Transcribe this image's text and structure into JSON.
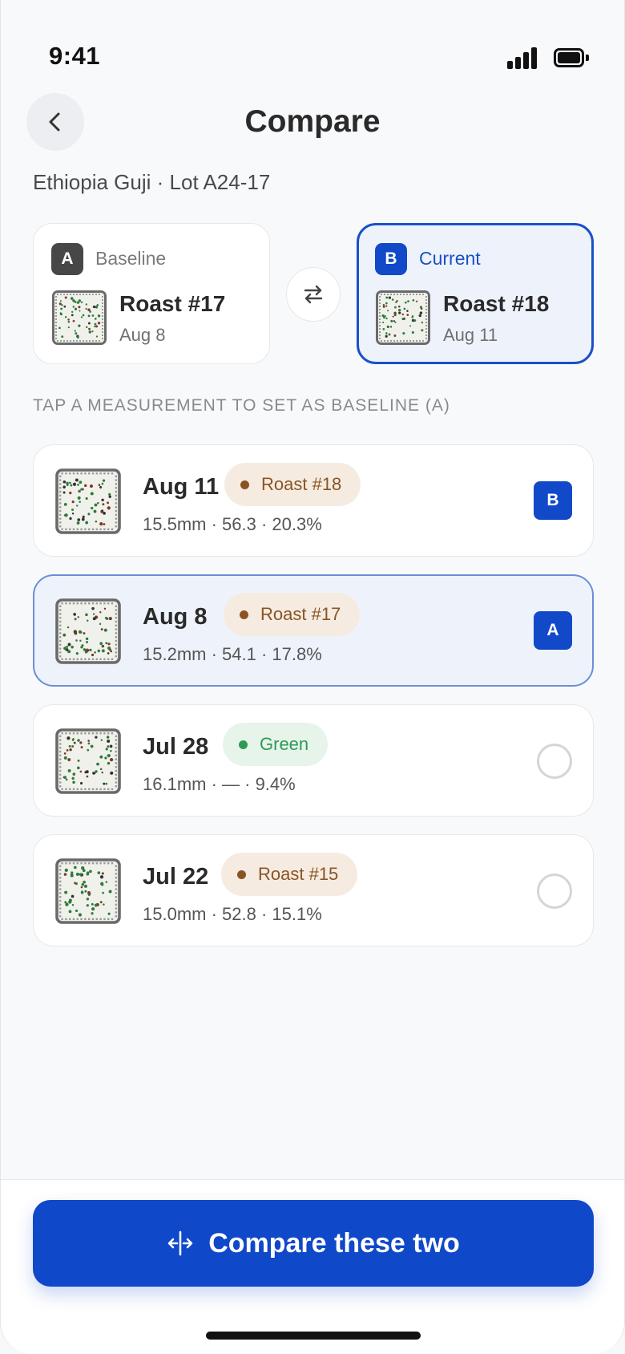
{
  "status_bar": {
    "time": "9:41"
  },
  "header": {
    "title": "Compare",
    "subtitle": "Ethiopia Guji · Lot A24-17"
  },
  "compare": {
    "a": {
      "badge": "A",
      "role": "Baseline",
      "name": "Roast #17",
      "date": "Aug 8"
    },
    "b": {
      "badge": "B",
      "role": "Current",
      "name": "Roast #18",
      "date": "Aug 11"
    }
  },
  "section_label": "TAP A MEASUREMENT TO SET AS BASELINE (A)",
  "measurements": [
    {
      "date": "Aug 11",
      "tag": "Roast #18",
      "meta": "15.5mm · 56.3 · 20.3%",
      "badge": "B"
    },
    {
      "date": "Aug 8",
      "tag": "Roast #17",
      "meta": "15.2mm · 54.1 · 17.8%",
      "badge": "A"
    },
    {
      "date": "Jul 28",
      "tag": "Green",
      "meta": "16.1mm · — · 9.4%"
    },
    {
      "date": "Jul 22",
      "tag": "Roast #15",
      "meta": "15.0mm · 52.8 · 15.1%"
    }
  ],
  "cta": {
    "label": "Compare these two"
  },
  "colors": {
    "primary": "#0f48c8",
    "roast_pill_bg": "#f5ebe1",
    "roast_pill_text": "#8a5422",
    "green_pill_bg": "#e6f4ea",
    "green_pill_text": "#2f9a55",
    "selected_bg": "#eef3fb"
  },
  "icons": [
    "chevron-left-icon",
    "swap-icon",
    "compare-split-icon",
    "signal-icon",
    "battery-icon"
  ]
}
